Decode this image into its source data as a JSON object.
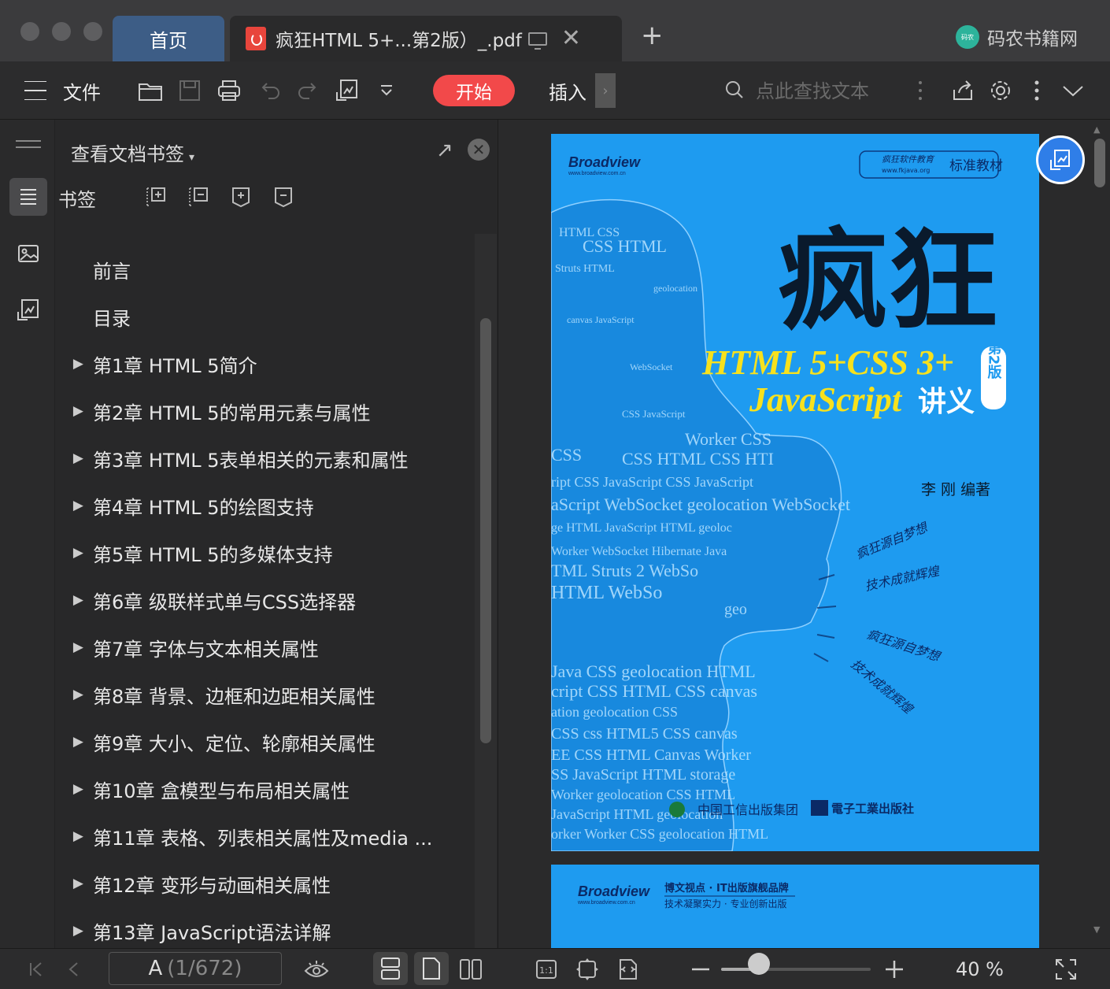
{
  "tabs": {
    "home_label": "首页",
    "doc_label": "疯狂HTML 5+...第2版）_.pdf",
    "close_glyph": "✕",
    "new_tab_glyph": "+"
  },
  "brand": {
    "logo_text": "码农",
    "name": "码农书籍网"
  },
  "toolbar": {
    "file_label": "文件",
    "start_label": "开始",
    "insert_label": "插入",
    "more_glyph": "›",
    "search_placeholder": "点此查找文本"
  },
  "panel": {
    "header_label": "查看文档书签",
    "caret": "▾",
    "popout_glyph": "↗",
    "close_glyph": "✕",
    "bookmark_label": "书签",
    "items": [
      {
        "label": "前言",
        "expandable": false
      },
      {
        "label": "目录",
        "expandable": false
      },
      {
        "label": "第1章 HTML 5简介",
        "expandable": true
      },
      {
        "label": "第2章 HTML 5的常用元素与属性",
        "expandable": true
      },
      {
        "label": "第3章 HTML 5表单相关的元素和属性",
        "expandable": true
      },
      {
        "label": "第4章 HTML 5的绘图支持",
        "expandable": true
      },
      {
        "label": "第5章 HTML 5的多媒体支持",
        "expandable": true
      },
      {
        "label": "第6章 级联样式单与CSS选择器",
        "expandable": true
      },
      {
        "label": "第7章 字体与文本相关属性",
        "expandable": true
      },
      {
        "label": "第8章 背景、边框和边距相关属性",
        "expandable": true
      },
      {
        "label": "第9章 大小、定位、轮廓相关属性",
        "expandable": true
      },
      {
        "label": "第10章 盒模型与布局相关属性",
        "expandable": true
      },
      {
        "label": "第11章 表格、列表相关属性及media ...",
        "expandable": true
      },
      {
        "label": "第12章 变形与动画相关属性",
        "expandable": true
      },
      {
        "label": "第13章 JavaScript语法详解",
        "expandable": true
      }
    ],
    "arrow_glyph": "▶"
  },
  "cover": {
    "publisher_logo": "Broadview",
    "publisher_url": "www.broadview.com.cn",
    "series_badge": "疯狂软件教育",
    "series_url": "www.fkjava.org",
    "series_tag": "标准教材",
    "title_cn": "疯狂",
    "subtitle_1": "HTML 5+CSS 3+",
    "subtitle_2": "JavaScript",
    "subtitle_3": "讲义",
    "edition": "第2版",
    "author": "李 刚 编著",
    "slogan_1": "疯狂源自梦想",
    "slogan_2": "技术成就辉煌",
    "slogan_3": "疯狂源自梦想",
    "slogan_4": "技术成就辉煌",
    "press_1": "中国工信出版集团",
    "press_2": "電子工業出版社",
    "colors": {
      "cover_blue": "#1e9bf0",
      "title_yellow": "#f7e11d"
    }
  },
  "page2": {
    "publisher_logo": "Broadview",
    "publisher_url": "www.broadview.com.cn",
    "line1": "博文视点 · IT出版旗舰品牌",
    "line2": "技术凝聚实力 · 专业创新出版"
  },
  "statusbar": {
    "page_letter": "A",
    "page_info": "(1/672)",
    "zoom_label": "40 %",
    "zoom_fraction": 0.25
  },
  "colors": {
    "accent_red": "#f2494a",
    "tab_blue": "#3d5d86",
    "fab_blue": "#2f7ee8"
  }
}
